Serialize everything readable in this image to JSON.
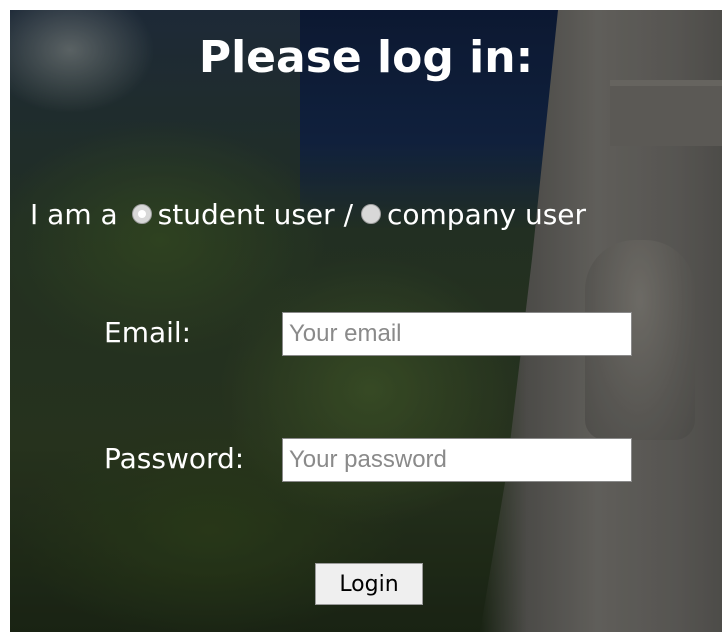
{
  "header": {
    "title": "Please log in:"
  },
  "role": {
    "prefix": "I am a",
    "options": [
      {
        "label": "student user /",
        "checked": true
      },
      {
        "label": "company user",
        "checked": false
      }
    ]
  },
  "email": {
    "label": "Email:",
    "placeholder": "Your email",
    "value": ""
  },
  "password": {
    "label": "Password:",
    "placeholder": "Your password",
    "value": ""
  },
  "actions": {
    "login_label": "Login"
  },
  "icons": {
    "radio": "radio-button-icon"
  }
}
